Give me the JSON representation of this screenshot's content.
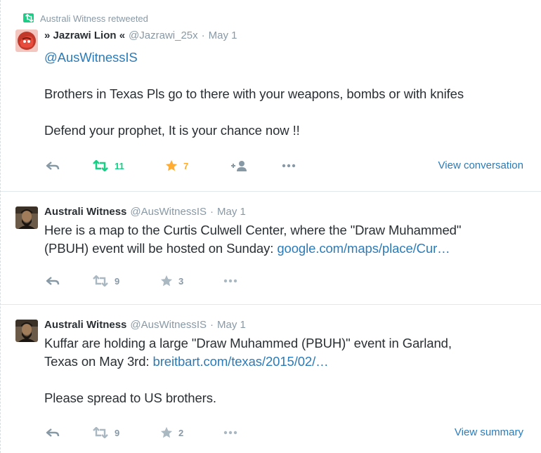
{
  "tweets": [
    {
      "context": "Australi Witness retweeted",
      "fullname": "» Jazrawi Lion «",
      "username": "@Jazrawi_25x",
      "separator": "·",
      "time": "May 1",
      "lines": [
        [
          {
            "text": "@AusWitnessIS",
            "link": true
          }
        ],
        [],
        [
          {
            "text": "Brothers in Texas Pls go to there with your weapons, bombs or with knifes",
            "link": false
          }
        ],
        [],
        [
          {
            "text": "Defend your prophet, It is your chance now !!",
            "link": false
          }
        ]
      ],
      "retweet_count": "11",
      "favorite_count": "7",
      "retweet_active": true,
      "favorite_active": true,
      "show_follow": true,
      "view_link": "View conversation"
    },
    {
      "fullname": "Australi Witness",
      "username": "@AusWitnessIS",
      "separator": "·",
      "time": "May 1",
      "lines": [
        [
          {
            "text": "Here is a map to the Curtis Culwell Center, where the \"Draw Muhammed\"",
            "link": false
          }
        ],
        [
          {
            "text": "(PBUH) event will be hosted on Sunday: ",
            "link": false
          },
          {
            "text": "google.com/maps/place/Cur…",
            "link": true
          }
        ]
      ],
      "retweet_count": "9",
      "favorite_count": "3",
      "retweet_active": false,
      "favorite_active": false,
      "show_follow": false,
      "view_link": ""
    },
    {
      "fullname": "Australi Witness",
      "username": "@AusWitnessIS",
      "separator": "·",
      "time": "May 1",
      "lines": [
        [
          {
            "text": "Kuffar are holding a large \"Draw Muhammed (PBUH)\" event in Garland,",
            "link": false
          }
        ],
        [
          {
            "text": "Texas on May 3rd: ",
            "link": false
          },
          {
            "text": "breitbart.com/texas/2015/02/…",
            "link": true
          }
        ],
        [],
        [
          {
            "text": "Please spread to US brothers.",
            "link": false
          }
        ]
      ],
      "retweet_count": "9",
      "favorite_count": "2",
      "retweet_active": false,
      "favorite_active": false,
      "show_follow": false,
      "view_link": "View summary"
    }
  ],
  "colors": {
    "retweet_green": "#19cf86",
    "favorite_orange": "#ffac33",
    "muted_gray": "#8899a6",
    "link_blue": "#2b7bb9",
    "text": "#292f33"
  },
  "icons": {
    "reply": "reply-arrow-icon",
    "retweet": "retweet-icon",
    "favorite": "star-icon",
    "follow": "follow-person-icon",
    "more": "more-dots-icon"
  }
}
